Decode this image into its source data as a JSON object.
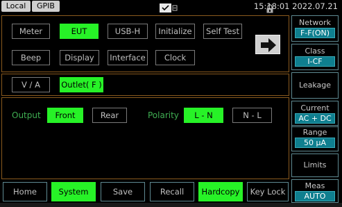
{
  "status": {
    "local": "Local",
    "gpib": "GPIB",
    "clock": "15:18:01 2022.07.21"
  },
  "menu_panel": {
    "buttons": {
      "meter": "Meter",
      "eut": "EUT",
      "usbh": "USB-H",
      "initialize": "Initialize",
      "selftest": "Self Test",
      "beep": "Beep",
      "display": "Display",
      "interface": "Interface",
      "clock": "Clock"
    },
    "selected": "EUT"
  },
  "eut_tabs": {
    "va": "V / A",
    "outlet": "Outlet( F )",
    "selected": "Outlet( F )"
  },
  "outlet": {
    "output_label": "Output",
    "front": "Front",
    "rear": "Rear",
    "output_selected": "Front",
    "polarity_label": "Polarity",
    "ln": "L - N",
    "nl": "N - L",
    "polarity_selected": "L - N"
  },
  "softkeys": {
    "network_title": "Network",
    "network_value": "F-F(ON)",
    "class_title": "Class",
    "class_value": "I-CF",
    "leakage": "Leakage",
    "current_title": "Current",
    "current_value": "AC + DC",
    "range_title": "Range",
    "range_value": "50 µA",
    "limits": "Limits",
    "meas_title": "Meas",
    "meas_value": "AUTO"
  },
  "bottom_menu": {
    "home": "Home",
    "system": "System",
    "save": "Save",
    "recall": "Recall",
    "hardcopy": "Hardcopy",
    "keylock": "Key Lock",
    "selected": [
      "System",
      "Hardcopy"
    ]
  },
  "colors": {
    "active_green": "#27f227",
    "label_green": "#3fae52",
    "panel_border": "#8a5a1e",
    "value_teal": "#0f7f8f"
  }
}
